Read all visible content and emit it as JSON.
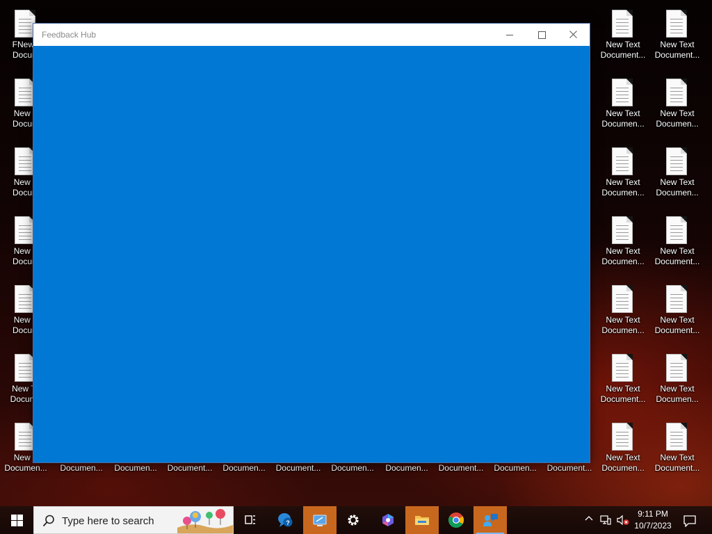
{
  "desktop": {
    "icons_left": [
      {
        "label": "FNewT\nDocum"
      },
      {
        "label": "New T\nDocum"
      },
      {
        "label": "New T\nDocum"
      },
      {
        "label": "New T\nDocum"
      },
      {
        "label": "New T\nDocum"
      },
      {
        "label": "New Te\nDocume"
      },
      {
        "label": "New T\nDocumen..."
      }
    ],
    "icons_bottom": [
      {
        "label": "Documen..."
      },
      {
        "label": "Documen..."
      },
      {
        "label": "Document..."
      },
      {
        "label": "Documen..."
      },
      {
        "label": "Document..."
      },
      {
        "label": "Documen..."
      },
      {
        "label": "Documen..."
      },
      {
        "label": "Document..."
      },
      {
        "label": "Documen..."
      },
      {
        "label": "Document..."
      }
    ],
    "icons_right_col1": [
      {
        "label": "New Text\nDocument..."
      },
      {
        "label": "New Text\nDocumen..."
      },
      {
        "label": "New Text\nDocumen..."
      },
      {
        "label": "New Text\nDocumen..."
      },
      {
        "label": "New Text\nDocumen..."
      },
      {
        "label": "New Text\nDocument..."
      },
      {
        "label": "New Text\nDocumen..."
      }
    ],
    "icons_right_col2": [
      {
        "label": "New Text\nDocument..."
      },
      {
        "label": "New Text\nDocumen..."
      },
      {
        "label": "New Text\nDocumen..."
      },
      {
        "label": "New Text\nDocument..."
      },
      {
        "label": "New Text\nDocument..."
      },
      {
        "label": "New Text\nDocumen..."
      },
      {
        "label": "New Text\nDocument..."
      }
    ]
  },
  "window": {
    "title": "Feedback Hub",
    "content_color": "#0078d4"
  },
  "taskbar": {
    "search_placeholder": "Type here to search",
    "apps": [
      {
        "icon": "task-view-icon"
      },
      {
        "icon": "get-help-icon"
      },
      {
        "icon": "remote-desktop-icon"
      },
      {
        "icon": "settings-gear-icon"
      },
      {
        "icon": "copilot-icon"
      },
      {
        "icon": "file-explorer-icon"
      },
      {
        "icon": "chrome-icon"
      },
      {
        "icon": "feedback-hub-icon"
      }
    ],
    "clock_time": "9:11 PM",
    "clock_date": "10/7/2023"
  },
  "colors": {
    "accent": "#0078d4",
    "highlight": "#c8681f",
    "taskbar": "#1c0b08"
  }
}
